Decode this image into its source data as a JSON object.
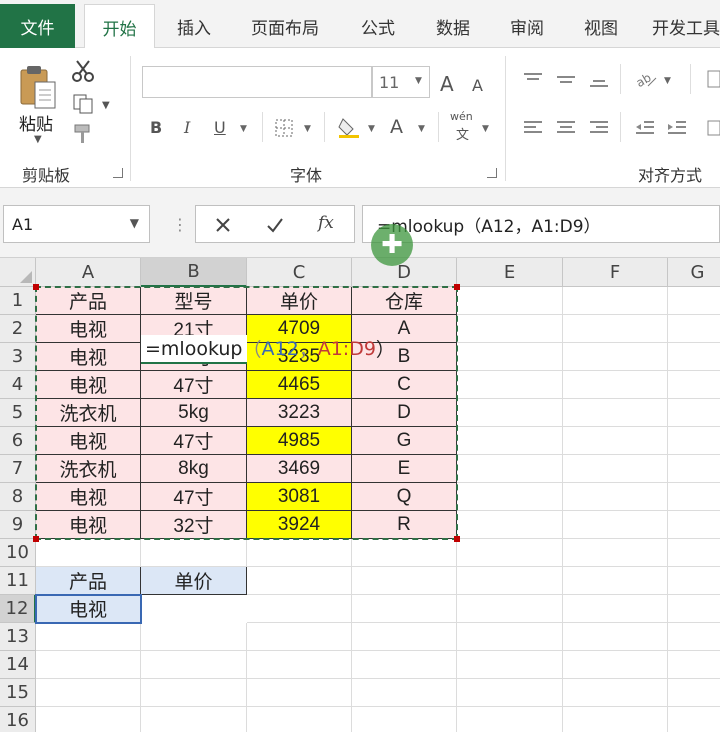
{
  "ribbon": {
    "tabs": [
      "文件",
      "开始",
      "插入",
      "页面布局",
      "公式",
      "数据",
      "审阅",
      "视图",
      "开发工具"
    ],
    "active_tab": "开始",
    "clipboard": {
      "paste_label": "粘贴",
      "group_label": "剪贴板"
    },
    "font": {
      "size_value": "11",
      "group_label": "字体",
      "bold": "B",
      "italic": "I",
      "underline": "U",
      "grow": "A",
      "shrink": "A",
      "font_color": "A",
      "phonetic_top": "wén",
      "phonetic_bottom": "文"
    },
    "alignment": {
      "group_label": "对齐方式"
    }
  },
  "formula_bar": {
    "name_box": "A1",
    "fx_label": "fx",
    "formula": "=mlookup（A12，A1:D9）"
  },
  "grid": {
    "columns": [
      "A",
      "B",
      "C",
      "D",
      "E",
      "F",
      "G"
    ],
    "rows": [
      "1",
      "2",
      "3",
      "4",
      "5",
      "6",
      "7",
      "8",
      "9",
      "10",
      "11",
      "12",
      "13",
      "14",
      "15",
      "16"
    ],
    "table": [
      [
        "产品",
        "型号",
        "单价",
        "仓库"
      ],
      [
        "电视",
        "21寸",
        "4709",
        "A"
      ],
      [
        "电视",
        "32寸",
        "3235",
        "B"
      ],
      [
        "电视",
        "47寸",
        "4465",
        "C"
      ],
      [
        "洗衣机",
        "5kg",
        "3223",
        "D"
      ],
      [
        "电视",
        "47寸",
        "4985",
        "G"
      ],
      [
        "洗衣机",
        "8kg",
        "3469",
        "E"
      ],
      [
        "电视",
        "47寸",
        "3081",
        "Q"
      ],
      [
        "电视",
        "32寸",
        "3924",
        "R"
      ]
    ],
    "yellow_price_rows": [
      1,
      2,
      3,
      5,
      7,
      8
    ],
    "lookup_header": [
      "产品",
      "单价"
    ],
    "lookup_value": "电视",
    "edit_formula": {
      "prefix": "=mlookup",
      "open": "（",
      "ref1": "A12",
      "sep": "，",
      "ref2": "A1:D9",
      "close": "）"
    }
  },
  "colors": {
    "excel_green": "#217346",
    "pink_fill": "#fde4e6",
    "yellow_fill": "#ffff00",
    "blue_fill": "#dce7f6",
    "ref_blue": "#3968b3",
    "ref_red": "#c03a3a"
  },
  "icons": [
    "paste-icon",
    "cut-icon",
    "copy-icon",
    "format-painter-icon",
    "borders-icon",
    "fill-color-icon",
    "align-icons",
    "orientation-icon",
    "indent-icons",
    "fx-icon",
    "cancel-icon",
    "enter-icon",
    "select-all-icon",
    "move-cursor-icon"
  ]
}
